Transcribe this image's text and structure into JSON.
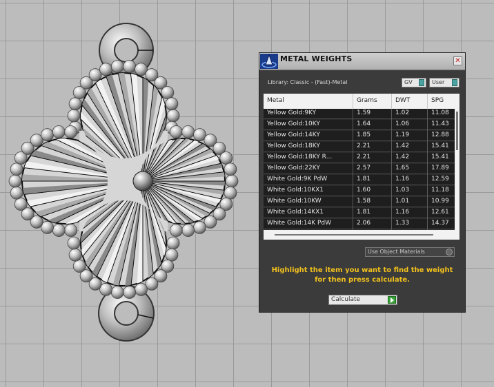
{
  "panel": {
    "title": "METAL WEIGHTS",
    "close_label": "✕",
    "library": "Library: Classic - (Fast)-Metal",
    "toggle_gv": "GV",
    "toggle_user": "User",
    "columns": [
      "Metal",
      "Grams",
      "DWT",
      "SPG"
    ],
    "rows": [
      [
        "Yellow Gold:9KY",
        "1.59",
        "1.02",
        "11.08"
      ],
      [
        "Yellow Gold:10KY",
        "1.64",
        "1.06",
        "11.43"
      ],
      [
        "Yellow Gold:14KY",
        "1.85",
        "1.19",
        "12.88"
      ],
      [
        "Yellow Gold:18KY",
        "2.21",
        "1.42",
        "15.41"
      ],
      [
        "Yellow Gold:18KY R...",
        "2.21",
        "1.42",
        "15.41"
      ],
      [
        "Yellow Gold:22KY",
        "2.57",
        "1.65",
        "17.89"
      ],
      [
        "White Gold:9K PdW",
        "1.81",
        "1.16",
        "12.59"
      ],
      [
        "White Gold:10KX1",
        "1.60",
        "1.03",
        "11.18"
      ],
      [
        "White Gold:10KW",
        "1.58",
        "1.01",
        "10.99"
      ],
      [
        "White Gold:14KX1",
        "1.81",
        "1.16",
        "12.61"
      ],
      [
        "White Gold:14K PdW",
        "2.06",
        "1.33",
        "14.37"
      ]
    ],
    "use_object_materials": "Use Object Materials",
    "hint": "Highlight the item you want to find the weight for then press calculate.",
    "calculate": "Calculate"
  },
  "colors": {
    "viewport_bg": "#bcbcbc",
    "panel_bg": "#3b3b3b",
    "hint_text": "#f3c21c",
    "toggle_knob": "#4aa3a0",
    "calc_arrow": "#3aa23a"
  },
  "icons": {
    "title_logo": "rhino-logo-icon",
    "close": "close-icon",
    "calculate": "play-arrow-icon"
  }
}
